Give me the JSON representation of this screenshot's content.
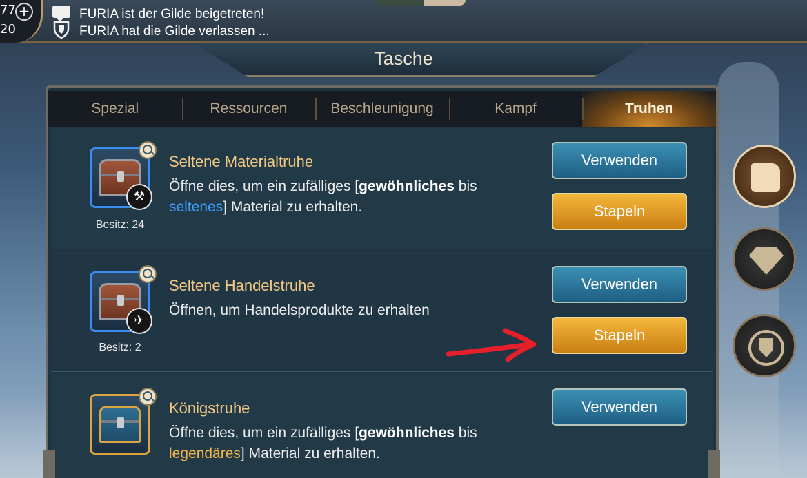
{
  "topbar": {
    "counter_top": "77",
    "counter_bottom": "20",
    "messages": [
      "FURIA ist der Gilde beigetreten!",
      "FURIA hat die Gilde verlassen ..."
    ]
  },
  "title": "Tasche",
  "tabs": [
    {
      "label": "Spezial",
      "active": false
    },
    {
      "label": "Ressourcen",
      "active": false
    },
    {
      "label": "Beschleunigung",
      "active": false
    },
    {
      "label": "Kampf",
      "active": false
    },
    {
      "label": "Truhen",
      "active": true
    }
  ],
  "items": [
    {
      "title": "Seltene Materialtruhe",
      "desc_pre": "Öffne dies, um ein zufälliges [",
      "desc_hl1": "gewöhnliches",
      "desc_mid": " bis",
      "desc_hl2": "seltenes",
      "desc_post": "] Material zu erhalten.",
      "owned": "Besitz: 24",
      "badge_icon": "anvil-icon",
      "use_label": "Verwenden",
      "stack_label": "Stapeln"
    },
    {
      "title": "Seltene Handelstruhe",
      "desc": "Öffnen, um Handelsprodukte zu erhalten",
      "owned": "Besitz: 2",
      "badge_icon": "airship-icon",
      "use_label": "Verwenden",
      "stack_label": "Stapeln"
    },
    {
      "title": "Königstruhe",
      "desc_pre": "Öffne dies, um ein zufälliges [",
      "desc_hl1": "gewöhnliches",
      "desc_mid": " bis",
      "desc_hl2": "legendäres",
      "desc_post": "] Material zu erhalten.",
      "use_label": "Verwenden"
    }
  ],
  "colors": {
    "accent_gold": "#f1c882",
    "rare_blue": "#3ea0ff",
    "legendary_gold": "#f0b449",
    "annotation_red": "#e5202a"
  },
  "side_icons": [
    "bag-icon",
    "gem-icon",
    "guild-coin-icon"
  ]
}
